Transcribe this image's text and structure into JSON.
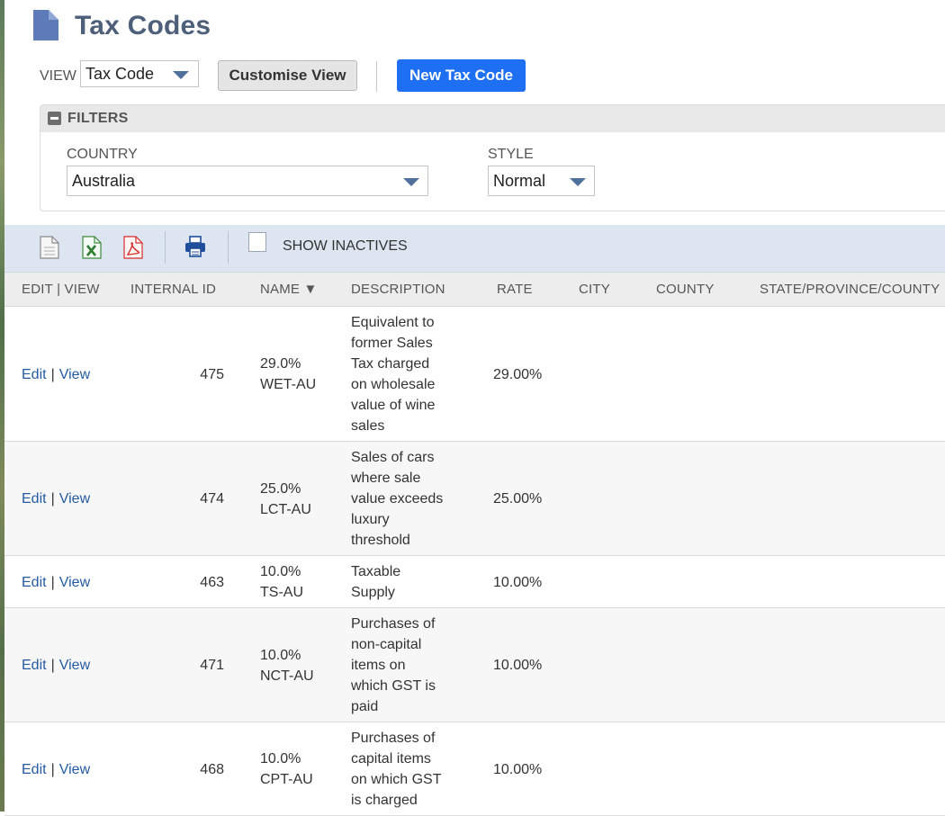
{
  "page": {
    "title": "Tax Codes"
  },
  "toolbar": {
    "view_label": "VIEW",
    "view_value": "Tax Code",
    "customise_label": "Customise View",
    "new_label": "New Tax Code"
  },
  "filters": {
    "title": "FILTERS",
    "country_label": "COUNTRY",
    "country_value": "Australia",
    "style_label": "STYLE",
    "style_value": "Normal"
  },
  "list_toolbar": {
    "show_inactives_label": "SHOW INACTIVES",
    "show_inactives_checked": false,
    "icons": [
      "export-csv-icon",
      "export-excel-icon",
      "export-pdf-icon",
      "print-icon"
    ]
  },
  "table": {
    "columns": [
      "EDIT | VIEW",
      "INTERNAL ID",
      "NAME ▼",
      "DESCRIPTION",
      "RATE",
      "CITY",
      "COUNTY",
      "STATE/PROVINCE/COUNTY"
    ],
    "edit_label": "Edit",
    "view_label": "View",
    "rows": [
      {
        "id": "475",
        "name": [
          "29.0%",
          "WET-AU"
        ],
        "description": [
          "Equivalent to",
          "former Sales",
          "Tax charged",
          "on wholesale",
          "value of wine",
          "sales"
        ],
        "rate": "29.00%"
      },
      {
        "id": "474",
        "name": [
          "25.0%",
          "LCT-AU"
        ],
        "description": [
          "Sales of cars",
          "where sale",
          "value exceeds",
          "luxury",
          "threshold"
        ],
        "rate": "25.00%"
      },
      {
        "id": "463",
        "name": [
          "10.0%",
          "TS-AU"
        ],
        "description": [
          "Taxable",
          "Supply"
        ],
        "rate": "10.00%"
      },
      {
        "id": "471",
        "name": [
          "10.0%",
          "NCT-AU"
        ],
        "description": [
          "Purchases of",
          "non-capital",
          "items on",
          "which GST is",
          "paid"
        ],
        "rate": "10.00%"
      },
      {
        "id": "468",
        "name": [
          "10.0%",
          "CPT-AU"
        ],
        "description": [
          "Purchases of",
          "capital items",
          "on which GST",
          "is charged"
        ],
        "rate": "10.00%"
      }
    ]
  },
  "colors": {
    "title": "#4d5f79",
    "primary_button": "#1e6ff2",
    "link": "#255ba3",
    "toolbar_bg": "#dde6f0"
  }
}
